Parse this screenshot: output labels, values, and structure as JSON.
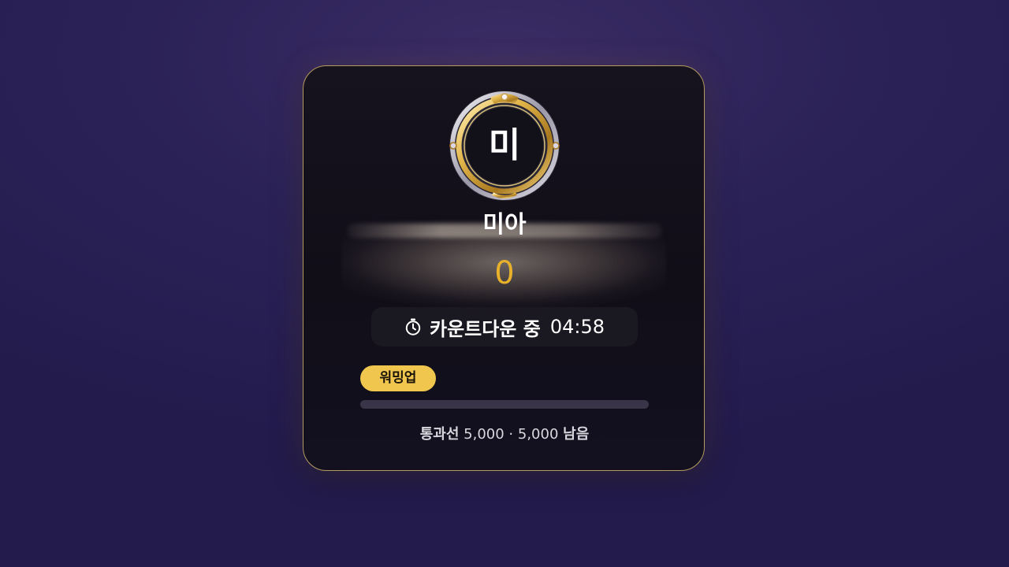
{
  "player": {
    "initial": "미",
    "name": "미아",
    "score": "0"
  },
  "countdown": {
    "icon": "stopwatch-icon",
    "label": "카운트다운 중",
    "time": "04:58"
  },
  "stage": {
    "badge": "워밍업",
    "progress": 0
  },
  "threshold": {
    "label": "통과선",
    "target": "5,000",
    "separator": "·",
    "remaining": "5,000",
    "remaining_suffix": "남음"
  },
  "colors": {
    "accent_gold": "#e8b12c",
    "badge_bg": "#f0c64f",
    "card_border": "#b39a5e",
    "background": "#2b2258"
  }
}
